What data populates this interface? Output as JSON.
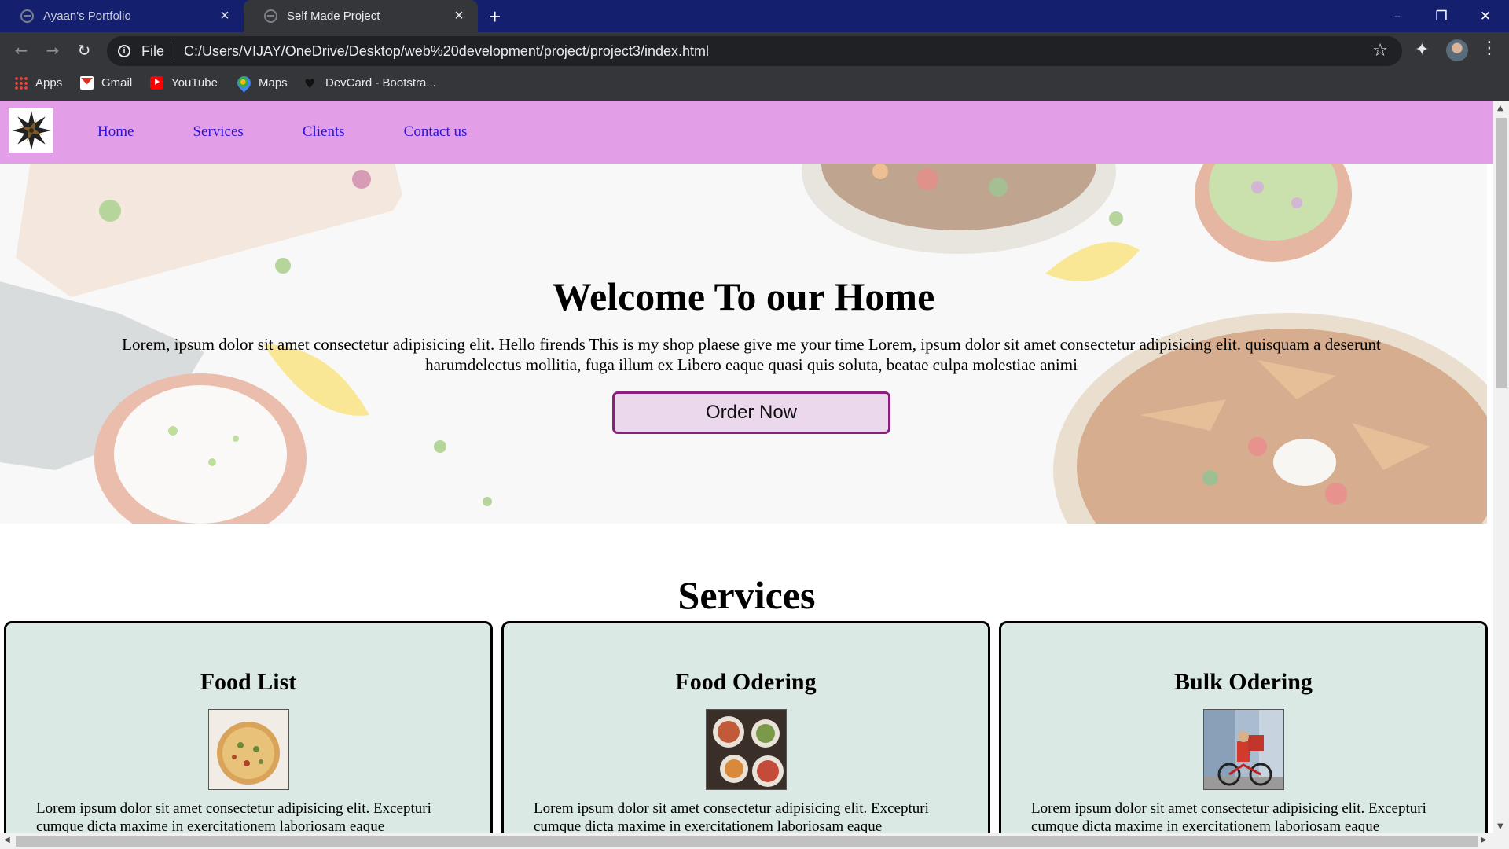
{
  "browser": {
    "tabs": [
      {
        "title": "Ayaan's Portfolio",
        "active": false
      },
      {
        "title": "Self Made Project",
        "active": true
      }
    ],
    "omnibox": {
      "scheme_label": "File",
      "url": "C:/Users/VIJAY/OneDrive/Desktop/web%20development/project/project3/index.html"
    },
    "bookmarks": [
      {
        "label": "Apps",
        "icon": "apps-grid-icon"
      },
      {
        "label": "Gmail",
        "icon": "gmail-icon"
      },
      {
        "label": "YouTube",
        "icon": "youtube-icon"
      },
      {
        "label": "Maps",
        "icon": "maps-icon"
      },
      {
        "label": "DevCard - Bootstra...",
        "icon": "heart-icon"
      }
    ]
  },
  "site": {
    "nav": {
      "links": [
        "Home",
        "Services",
        "Clients",
        "Contact us"
      ]
    },
    "hero": {
      "title": "Welcome To our Home",
      "text": "Lorem, ipsum dolor sit amet consectetur adipisicing elit. Hello firends This is my shop plaese give me your time Lorem, ipsum dolor sit amet consectetur adipisicing elit. quisquam a deserunt harumdelectus mollitia, fuga illum ex Libero eaque quasi quis soluta, beatae culpa molestiae animi",
      "button": "Order Now"
    },
    "services": {
      "title": "Services",
      "cards": [
        {
          "title": "Food List",
          "image": "pizza-image",
          "text": "Lorem ipsum dolor sit amet consectetur adipisicing elit. Excepturi cumque dicta maxime in exercitationem laboriosam eaque"
        },
        {
          "title": "Food Odering",
          "image": "bowls-image",
          "text": "Lorem ipsum dolor sit amet consectetur adipisicing elit. Excepturi cumque dicta maxime in exercitationem laboriosam eaque"
        },
        {
          "title": "Bulk Odering",
          "image": "delivery-cyclist-image",
          "text": "Lorem ipsum dolor sit amet consectetur adipisicing elit. Excepturi cumque dicta maxime in exercitationem laboriosam eaque"
        }
      ]
    }
  },
  "colors": {
    "tabbar": "#14206e",
    "chrome": "#35363a",
    "nav_bg": "#e29ee6",
    "nav_link": "#2b14d6",
    "card_bg": "#dbe9e5",
    "button_border": "#8a1f7d",
    "button_bg": "#ecd8ec"
  }
}
